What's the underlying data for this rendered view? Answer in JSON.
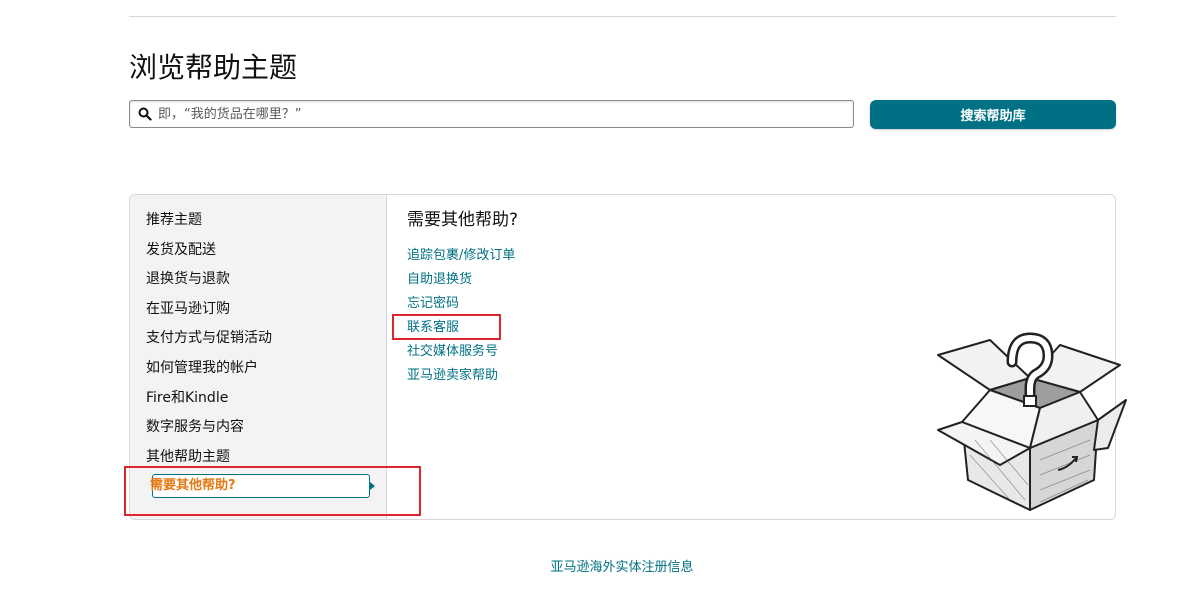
{
  "page": {
    "title": "浏览帮助主题"
  },
  "search": {
    "placeholder": "即，“我的货品在哪里？”",
    "value": "",
    "button_label": "搜索帮助库"
  },
  "topics": {
    "items": [
      "推荐主题",
      "发货及配送",
      "退换货与退款",
      "在亚马逊订购",
      "支付方式与促销活动",
      "如何管理我的帐户",
      "Fire和Kindle",
      "数字服务与内容",
      "其他帮助主题"
    ],
    "active": "需要其他帮助?"
  },
  "detail": {
    "heading": "需要其他帮助?",
    "links": [
      "追踪包裹/修改订单",
      "自助退换货",
      "忘记密码",
      "联系客服",
      "社交媒体服务号",
      "亚马逊卖家帮助"
    ]
  },
  "footer": {
    "link": "亚马逊海外实体注册信息"
  },
  "colors": {
    "accent": "#007185",
    "active_text": "#e47911",
    "highlight": "#e0262d",
    "nav_bg": "#f3f3f3"
  },
  "icons": {
    "search": "search-icon",
    "illustration": "question-box-illustration"
  }
}
